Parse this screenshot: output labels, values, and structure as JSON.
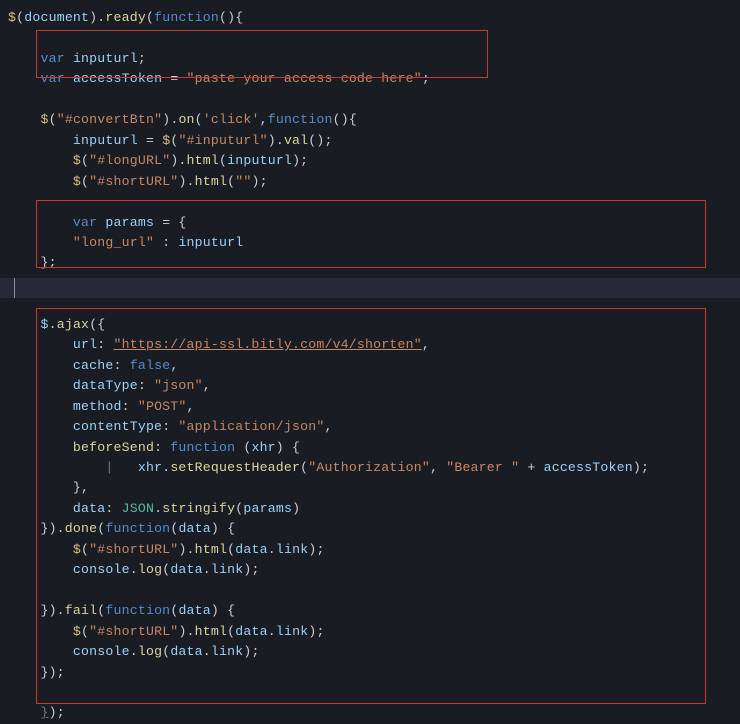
{
  "source_language": "javascript",
  "code": {
    "lines": [
      [
        [
          "c-gold",
          "$"
        ],
        [
          "c-punc",
          "("
        ],
        [
          "c-ident",
          "document"
        ],
        [
          "c-punc",
          ")."
        ],
        [
          "c-call",
          "ready"
        ],
        [
          "c-punc",
          "("
        ],
        [
          "c-key",
          "function"
        ],
        [
          "c-punc",
          "(){"
        ]
      ],
      [
        [
          "c-punc",
          ""
        ]
      ],
      [
        [
          "c-punc",
          "    "
        ],
        [
          "c-key",
          "var"
        ],
        [
          "c-punc",
          " "
        ],
        [
          "c-ident",
          "inputurl"
        ],
        [
          "c-punc",
          ";"
        ]
      ],
      [
        [
          "c-punc",
          "    "
        ],
        [
          "c-key",
          "var"
        ],
        [
          "c-punc",
          " "
        ],
        [
          "c-ident",
          "accessToken"
        ],
        [
          "c-punc",
          " = "
        ],
        [
          "c-str",
          "\"paste your access code here\""
        ],
        [
          "c-punc",
          ";"
        ]
      ],
      [
        [
          "c-punc",
          ""
        ]
      ],
      [
        [
          "c-punc",
          "    "
        ],
        [
          "c-gold",
          "$"
        ],
        [
          "c-punc",
          "("
        ],
        [
          "c-str",
          "\"#convertBtn\""
        ],
        [
          "c-punc",
          ")."
        ],
        [
          "c-call",
          "on"
        ],
        [
          "c-punc",
          "("
        ],
        [
          "c-str",
          "'click'"
        ],
        [
          "c-punc",
          ","
        ],
        [
          "c-key",
          "function"
        ],
        [
          "c-punc",
          "(){"
        ]
      ],
      [
        [
          "c-punc",
          "        "
        ],
        [
          "c-ident",
          "inputurl"
        ],
        [
          "c-punc",
          " = "
        ],
        [
          "c-gold",
          "$"
        ],
        [
          "c-punc",
          "("
        ],
        [
          "c-str",
          "\"#inputurl\""
        ],
        [
          "c-punc",
          ")."
        ],
        [
          "c-call",
          "val"
        ],
        [
          "c-punc",
          "();"
        ]
      ],
      [
        [
          "c-punc",
          "        "
        ],
        [
          "c-gold",
          "$"
        ],
        [
          "c-punc",
          "("
        ],
        [
          "c-str",
          "\"#longURL\""
        ],
        [
          "c-punc",
          ")."
        ],
        [
          "c-call",
          "html"
        ],
        [
          "c-punc",
          "("
        ],
        [
          "c-ident",
          "inputurl"
        ],
        [
          "c-punc",
          ");"
        ]
      ],
      [
        [
          "c-punc",
          "        "
        ],
        [
          "c-gold",
          "$"
        ],
        [
          "c-punc",
          "("
        ],
        [
          "c-str",
          "\"#shortURL\""
        ],
        [
          "c-punc",
          ")."
        ],
        [
          "c-call",
          "html"
        ],
        [
          "c-punc",
          "("
        ],
        [
          "c-str",
          "\"\""
        ],
        [
          "c-punc",
          ");"
        ]
      ],
      [
        [
          "c-punc",
          ""
        ]
      ],
      [
        [
          "c-punc",
          "        "
        ],
        [
          "c-key",
          "var"
        ],
        [
          "c-punc",
          " "
        ],
        [
          "c-ident",
          "params"
        ],
        [
          "c-punc",
          " = {"
        ]
      ],
      [
        [
          "c-punc",
          "        "
        ],
        [
          "c-str",
          "\"long_url\""
        ],
        [
          "c-punc",
          " "
        ],
        [
          "c-ident",
          ":"
        ],
        [
          "c-punc",
          " "
        ],
        [
          "c-ident",
          "inputurl"
        ]
      ],
      [
        [
          "c-punc",
          "    };"
        ]
      ],
      [
        [
          "c-punc",
          ""
        ]
      ],
      [
        [
          "c-punc",
          ""
        ]
      ],
      [
        [
          "c-punc",
          "    "
        ],
        [
          "c-ident",
          "$"
        ],
        [
          "c-punc",
          "."
        ],
        [
          "c-call",
          "ajax"
        ],
        [
          "c-punc",
          "({"
        ]
      ],
      [
        [
          "c-punc",
          "        "
        ],
        [
          "c-ident",
          "url"
        ],
        [
          "c-punc",
          ": "
        ],
        [
          "c-str c-ul",
          "\"https://api-ssl.bitly.com/v4/shorten\""
        ],
        [
          "c-punc",
          ","
        ]
      ],
      [
        [
          "c-punc",
          "        "
        ],
        [
          "c-ident",
          "cache"
        ],
        [
          "c-punc",
          ": "
        ],
        [
          "c-key",
          "false"
        ],
        [
          "c-punc",
          ","
        ]
      ],
      [
        [
          "c-punc",
          "        "
        ],
        [
          "c-ident",
          "dataType"
        ],
        [
          "c-punc",
          ": "
        ],
        [
          "c-str",
          "\"json\""
        ],
        [
          "c-punc",
          ","
        ]
      ],
      [
        [
          "c-punc",
          "        "
        ],
        [
          "c-ident",
          "method"
        ],
        [
          "c-punc",
          ": "
        ],
        [
          "c-str",
          "\"POST\""
        ],
        [
          "c-punc",
          ","
        ]
      ],
      [
        [
          "c-punc",
          "        "
        ],
        [
          "c-ident",
          "contentType"
        ],
        [
          "c-punc",
          ": "
        ],
        [
          "c-str",
          "\"application/json\""
        ],
        [
          "c-punc",
          ","
        ]
      ],
      [
        [
          "c-punc",
          "        "
        ],
        [
          "c-call",
          "beforeSend"
        ],
        [
          "c-punc",
          ": "
        ],
        [
          "c-key",
          "function"
        ],
        [
          "c-punc",
          " ("
        ],
        [
          "c-ident",
          "xhr"
        ],
        [
          "c-punc",
          ") {"
        ]
      ],
      [
        [
          "c-punc",
          "            "
        ],
        [
          "c-dim",
          "|"
        ],
        [
          "c-punc",
          "   "
        ],
        [
          "c-ident",
          "xhr"
        ],
        [
          "c-punc",
          "."
        ],
        [
          "c-call",
          "setRequestHeader"
        ],
        [
          "c-punc",
          "("
        ],
        [
          "c-str",
          "\"Authorization\""
        ],
        [
          "c-punc",
          ", "
        ],
        [
          "c-str",
          "\"Bearer \""
        ],
        [
          "c-punc",
          " + "
        ],
        [
          "c-ident",
          "accessToken"
        ],
        [
          "c-punc",
          ");"
        ]
      ],
      [
        [
          "c-punc",
          "        },"
        ]
      ],
      [
        [
          "c-punc",
          "        "
        ],
        [
          "c-ident",
          "data"
        ],
        [
          "c-punc",
          ": "
        ],
        [
          "c-obj",
          "JSON"
        ],
        [
          "c-punc",
          "."
        ],
        [
          "c-call",
          "stringify"
        ],
        [
          "c-punc",
          "("
        ],
        [
          "c-ident",
          "params"
        ],
        [
          "c-punc",
          ")"
        ]
      ],
      [
        [
          "c-punc",
          "    })."
        ],
        [
          "c-call",
          "done"
        ],
        [
          "c-punc",
          "("
        ],
        [
          "c-key",
          "function"
        ],
        [
          "c-punc",
          "("
        ],
        [
          "c-ident",
          "data"
        ],
        [
          "c-punc",
          ") {"
        ]
      ],
      [
        [
          "c-punc",
          "        "
        ],
        [
          "c-gold",
          "$"
        ],
        [
          "c-punc",
          "("
        ],
        [
          "c-str",
          "\"#shortURL\""
        ],
        [
          "c-punc",
          ")."
        ],
        [
          "c-call",
          "html"
        ],
        [
          "c-punc",
          "("
        ],
        [
          "c-ident",
          "data"
        ],
        [
          "c-punc",
          "."
        ],
        [
          "c-ident",
          "link"
        ],
        [
          "c-punc",
          ");"
        ]
      ],
      [
        [
          "c-punc",
          "        "
        ],
        [
          "c-ident",
          "console"
        ],
        [
          "c-punc",
          "."
        ],
        [
          "c-call",
          "log"
        ],
        [
          "c-punc",
          "("
        ],
        [
          "c-ident",
          "data"
        ],
        [
          "c-punc",
          "."
        ],
        [
          "c-ident",
          "link"
        ],
        [
          "c-punc",
          ");"
        ]
      ],
      [
        [
          "c-punc",
          ""
        ]
      ],
      [
        [
          "c-punc",
          "    })."
        ],
        [
          "c-call",
          "fail"
        ],
        [
          "c-punc",
          "("
        ],
        [
          "c-key",
          "function"
        ],
        [
          "c-punc",
          "("
        ],
        [
          "c-ident",
          "data"
        ],
        [
          "c-punc",
          ") {"
        ]
      ],
      [
        [
          "c-punc",
          "        "
        ],
        [
          "c-gold",
          "$"
        ],
        [
          "c-punc",
          "("
        ],
        [
          "c-str",
          "\"#shortURL\""
        ],
        [
          "c-punc",
          ")."
        ],
        [
          "c-call",
          "html"
        ],
        [
          "c-punc",
          "("
        ],
        [
          "c-ident",
          "data"
        ],
        [
          "c-punc",
          "."
        ],
        [
          "c-ident",
          "link"
        ],
        [
          "c-punc",
          ");"
        ]
      ],
      [
        [
          "c-punc",
          "        "
        ],
        [
          "c-ident",
          "console"
        ],
        [
          "c-punc",
          "."
        ],
        [
          "c-call",
          "log"
        ],
        [
          "c-punc",
          "("
        ],
        [
          "c-ident",
          "data"
        ],
        [
          "c-punc",
          "."
        ],
        [
          "c-ident",
          "link"
        ],
        [
          "c-punc",
          ");"
        ]
      ],
      [
        [
          "c-punc",
          "    });"
        ]
      ],
      [
        [
          "c-punc",
          ""
        ]
      ],
      [
        [
          "c-punc",
          "    "
        ],
        [
          "c-dim c-ul",
          "}"
        ],
        [
          "c-punc",
          ");"
        ]
      ]
    ]
  }
}
